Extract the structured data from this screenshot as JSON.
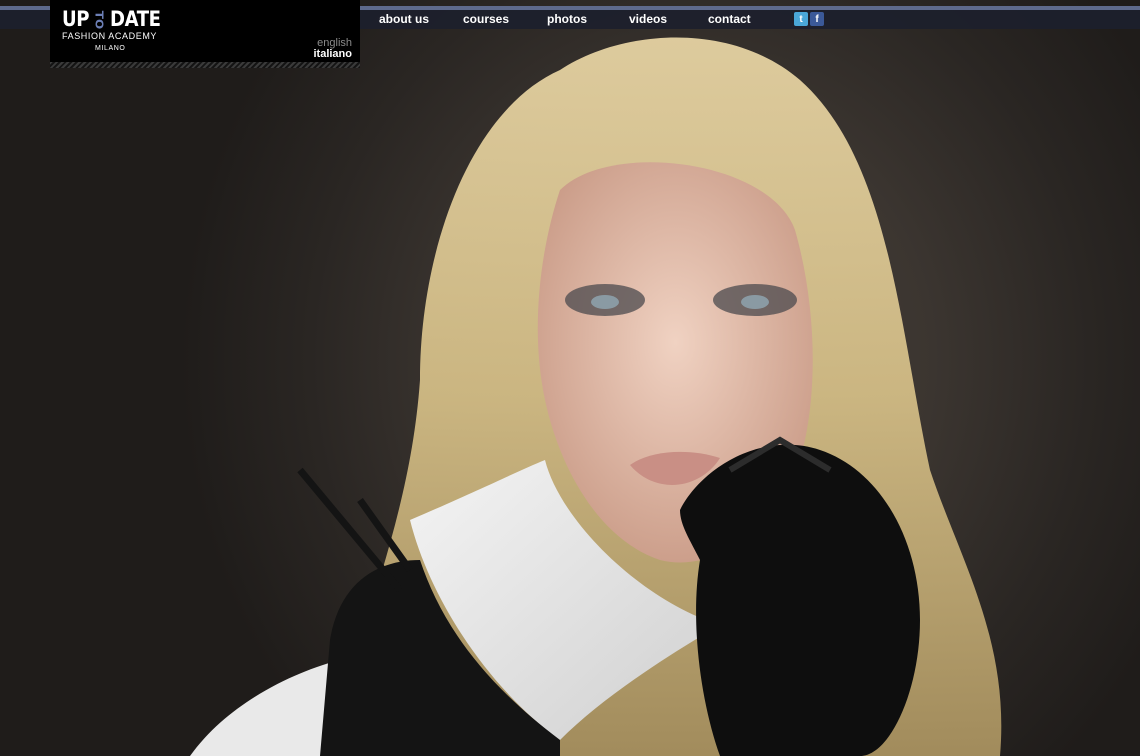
{
  "brand": {
    "logo_left": "UP",
    "logo_mid": "TO",
    "logo_right": "DATE",
    "subtitle": "FASHION ACADEMY",
    "city": "MILANO"
  },
  "languages": {
    "english": "english",
    "italiano": "italiano",
    "selected": "italiano"
  },
  "nav": {
    "about": "about us",
    "courses": "courses",
    "photos": "photos",
    "videos": "videos",
    "contact": "contact"
  },
  "social": {
    "twitter_icon": "twitter-icon",
    "facebook_icon": "facebook-icon",
    "twitter_glyph": "t",
    "facebook_glyph": "f"
  },
  "hero": {
    "icon": "fashion-model-photo"
  },
  "colors": {
    "accent": "#5e6a8c",
    "logo_accent": "#6c7fb6",
    "navbar": "#1c202c",
    "background": "#2a2623"
  }
}
